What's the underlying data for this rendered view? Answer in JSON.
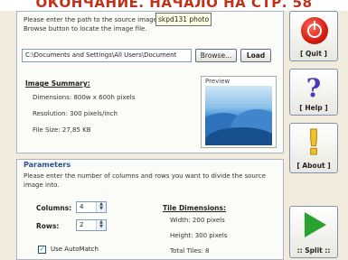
{
  "banner": {
    "text": "ОКОНЧАНИЕ. НАЧАЛО НА СТР. 58"
  },
  "tooltip": "skpd131 photo",
  "intro": "Please enter the path to the source image file, or use the Browse button to locate the image file.",
  "path_value": "C:\\Documents and Settings\\All Users\\Document",
  "browse_label": "Browse...",
  "load_label": "Load",
  "summary": {
    "title": "Image Summary:",
    "dimensions": "Dimensions: 800w x 600h pixels",
    "resolution": "Resolution: 300 pixels/inch",
    "filesize": "File Size: 27,85 KB"
  },
  "preview_label": "Preview",
  "parameters": {
    "title": "Parameters",
    "intro": "Please enter the number of columns and rows you want to divide the source image into.",
    "columns_label": "Columns:",
    "columns_value": "4",
    "rows_label": "Rows:",
    "rows_value": "2",
    "automatch_label": "Use AutoMatch",
    "automatch_checked": "true"
  },
  "tile": {
    "title": "Tile Dimensions:",
    "width": "Width: 200 pixels",
    "height": "Height: 300 pixels",
    "total": "Total Tiles: 8"
  },
  "side": {
    "quit": "[ Quit ]",
    "help": "[ Help ]",
    "about": "[ About ]",
    "split": ":: Split ::"
  },
  "colors": {
    "banner_text": "#c0311c",
    "quit_red": "#d51c12",
    "help_blue": "#4b3bb8",
    "about_yellow": "#f2c12e",
    "split_green": "#29a32d"
  }
}
